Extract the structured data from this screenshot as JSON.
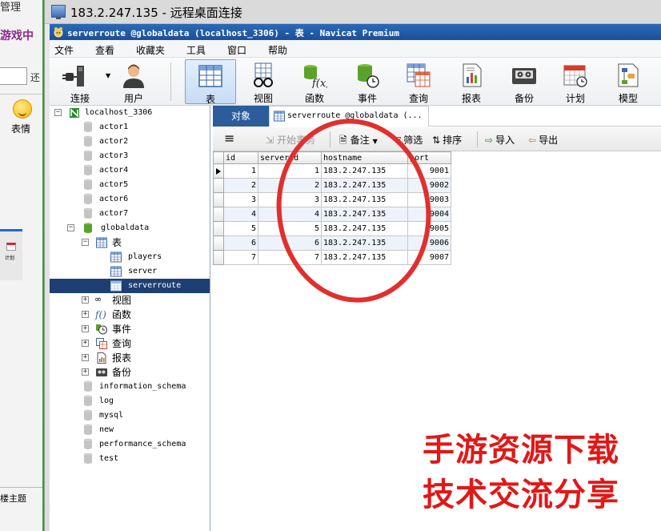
{
  "background_window": {
    "title_fragment": "管理",
    "heading_fragment": "游戏中",
    "side_text": "还",
    "emoji_label": "表情",
    "thumbnail_label": "计划",
    "footer_fragment": "楼主题"
  },
  "rdp": {
    "title": "183.2.247.135 - 远程桌面连接"
  },
  "navicat": {
    "title": "serverroute @globaldata (localhost_3306) - 表 - Navicat Premium",
    "menu": [
      "文件",
      "查看",
      "收藏夹",
      "工具",
      "窗口",
      "帮助"
    ],
    "toolbar": [
      {
        "label": "连接",
        "icon": "plug-icon"
      },
      {
        "label": "用户",
        "icon": "user-icon"
      },
      {
        "label": "表",
        "icon": "table-icon",
        "active": true
      },
      {
        "label": "视图",
        "icon": "view-glasses-icon"
      },
      {
        "label": "函数",
        "icon": "function-icon"
      },
      {
        "label": "事件",
        "icon": "event-clock-icon"
      },
      {
        "label": "查询",
        "icon": "query-icon"
      },
      {
        "label": "报表",
        "icon": "report-icon"
      },
      {
        "label": "备份",
        "icon": "backup-tape-icon"
      },
      {
        "label": "计划",
        "icon": "schedule-calendar-icon"
      },
      {
        "label": "模型",
        "icon": "model-icon"
      }
    ],
    "tree": {
      "connection": "localhost_3306",
      "databases_before": [
        "actor1",
        "actor2",
        "actor3",
        "actor4",
        "actor5",
        "actor6",
        "actor7"
      ],
      "open_database": "globaldata",
      "tables_folder": "表",
      "tables": [
        "players",
        "server",
        "serverroute"
      ],
      "selected_table": "serverroute",
      "folders": [
        "视图",
        "函数",
        "事件",
        "查询",
        "报表",
        "备份"
      ],
      "databases_after": [
        "information_schema",
        "log",
        "mysql",
        "new",
        "performance_schema",
        "test"
      ]
    },
    "tabs": {
      "objects": "对象",
      "table_tab": "serverroute @globaldata (..."
    },
    "grid_toolbar": {
      "menu_icon": "≡",
      "begin_transaction": "开始事务",
      "memo": "备注",
      "filter": "筛选",
      "sort": "排序",
      "import": "导入",
      "export": "导出"
    },
    "grid": {
      "columns": [
        "id",
        "serverid",
        "hostname",
        "port"
      ],
      "rows": [
        [
          "1",
          "1",
          "183.2.247.135",
          "9001"
        ],
        [
          "2",
          "2",
          "183.2.247.135",
          "9002"
        ],
        [
          "3",
          "3",
          "183.2.247.135",
          "9003"
        ],
        [
          "4",
          "4",
          "183.2.247.135",
          "9004"
        ],
        [
          "5",
          "5",
          "183.2.247.135",
          "9005"
        ],
        [
          "6",
          "6",
          "183.2.247.135",
          "9006"
        ],
        [
          "7",
          "7",
          "183.2.247.135",
          "9007"
        ]
      ]
    }
  },
  "watermark": {
    "line1": "手游资源下载",
    "line2": "技术交流分享"
  },
  "colors": {
    "annotation_red": "#e0302e",
    "watermark_red": "#e11818",
    "selection_navy": "#1e3f73",
    "title_blue": "#2b6ab8",
    "objects_tab_blue": "#2a5d9a"
  }
}
